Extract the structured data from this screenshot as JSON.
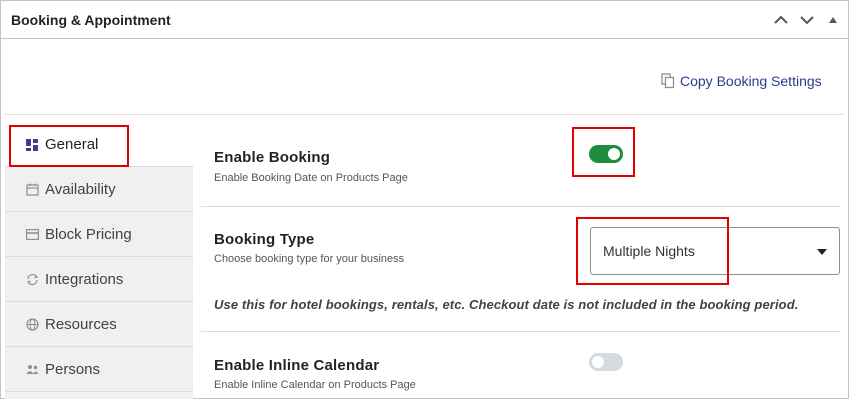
{
  "panel": {
    "title": "Booking & Appointment",
    "copy_link": "Copy Booking Settings"
  },
  "sidebar": {
    "items": [
      {
        "label": "General",
        "icon": "grid-icon",
        "active": true
      },
      {
        "label": "Availability",
        "icon": "calendar-icon",
        "active": false
      },
      {
        "label": "Block Pricing",
        "icon": "card-icon",
        "active": false
      },
      {
        "label": "Integrations",
        "icon": "sync-icon",
        "active": false
      },
      {
        "label": "Resources",
        "icon": "globe-icon",
        "active": false
      },
      {
        "label": "Persons",
        "icon": "people-icon",
        "active": false
      }
    ]
  },
  "settings": {
    "enable_booking": {
      "title": "Enable Booking",
      "description": "Enable Booking Date on Products Page",
      "enabled": true
    },
    "booking_type": {
      "title": "Booking Type",
      "description": "Choose booking type for your business",
      "selected": "Multiple Nights",
      "note": "Use this for hotel bookings, rentals, etc. Checkout date is not included in the booking period."
    },
    "inline_calendar": {
      "title": "Enable Inline Calendar",
      "description": "Enable Inline Calendar on Products Page",
      "enabled": false
    }
  },
  "colors": {
    "toggle_on": "#1e8d3d",
    "toggle_off": "#d5d9e0",
    "highlight": "#e00000",
    "link": "#2f3a8f"
  }
}
